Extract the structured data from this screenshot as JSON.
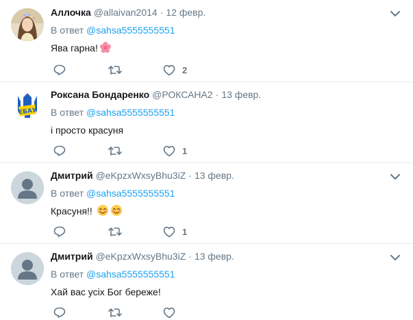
{
  "reply_prefix": "В ответ",
  "tweets": [
    {
      "name": "Аллочка",
      "handle": "@allaivan2014",
      "separator": "·",
      "date": "12 февр.",
      "reply_to": "@sahsa5555555551",
      "text": "Ява гарна!",
      "emoji": "hibiscus-flower",
      "likes": "2",
      "avatar": "woman-portrait"
    },
    {
      "name": "Роксана Бондаренко",
      "handle": "@РОКСАНА2",
      "separator": "·",
      "date": "13 февр.",
      "reply_to": "@sahsa5555555551",
      "text": "і просто красуня",
      "likes": "1",
      "avatar": "trident-emblem"
    },
    {
      "name": "Дмитрий",
      "handle": "@eKpzxWxsyBhu3iZ",
      "separator": "·",
      "date": "13 февр.",
      "reply_to": "@sahsa5555555551",
      "text": "Красуня!!",
      "emoji": "smiling-face-with-smiling-eyes x2",
      "likes": "1",
      "avatar": "default-profile"
    },
    {
      "name": "Дмитрий",
      "handle": "@eKpzxWxsyBhu3iZ",
      "separator": "·",
      "date": "13 февр.",
      "reply_to": "@sahsa5555555551",
      "text": "Хай вас усіх Бог береже!",
      "likes": "",
      "avatar": "default-profile"
    }
  ],
  "colors": {
    "link": "#1da1f2",
    "secondary": "#657786",
    "text": "#14171a",
    "divider": "#e6ecf0"
  }
}
